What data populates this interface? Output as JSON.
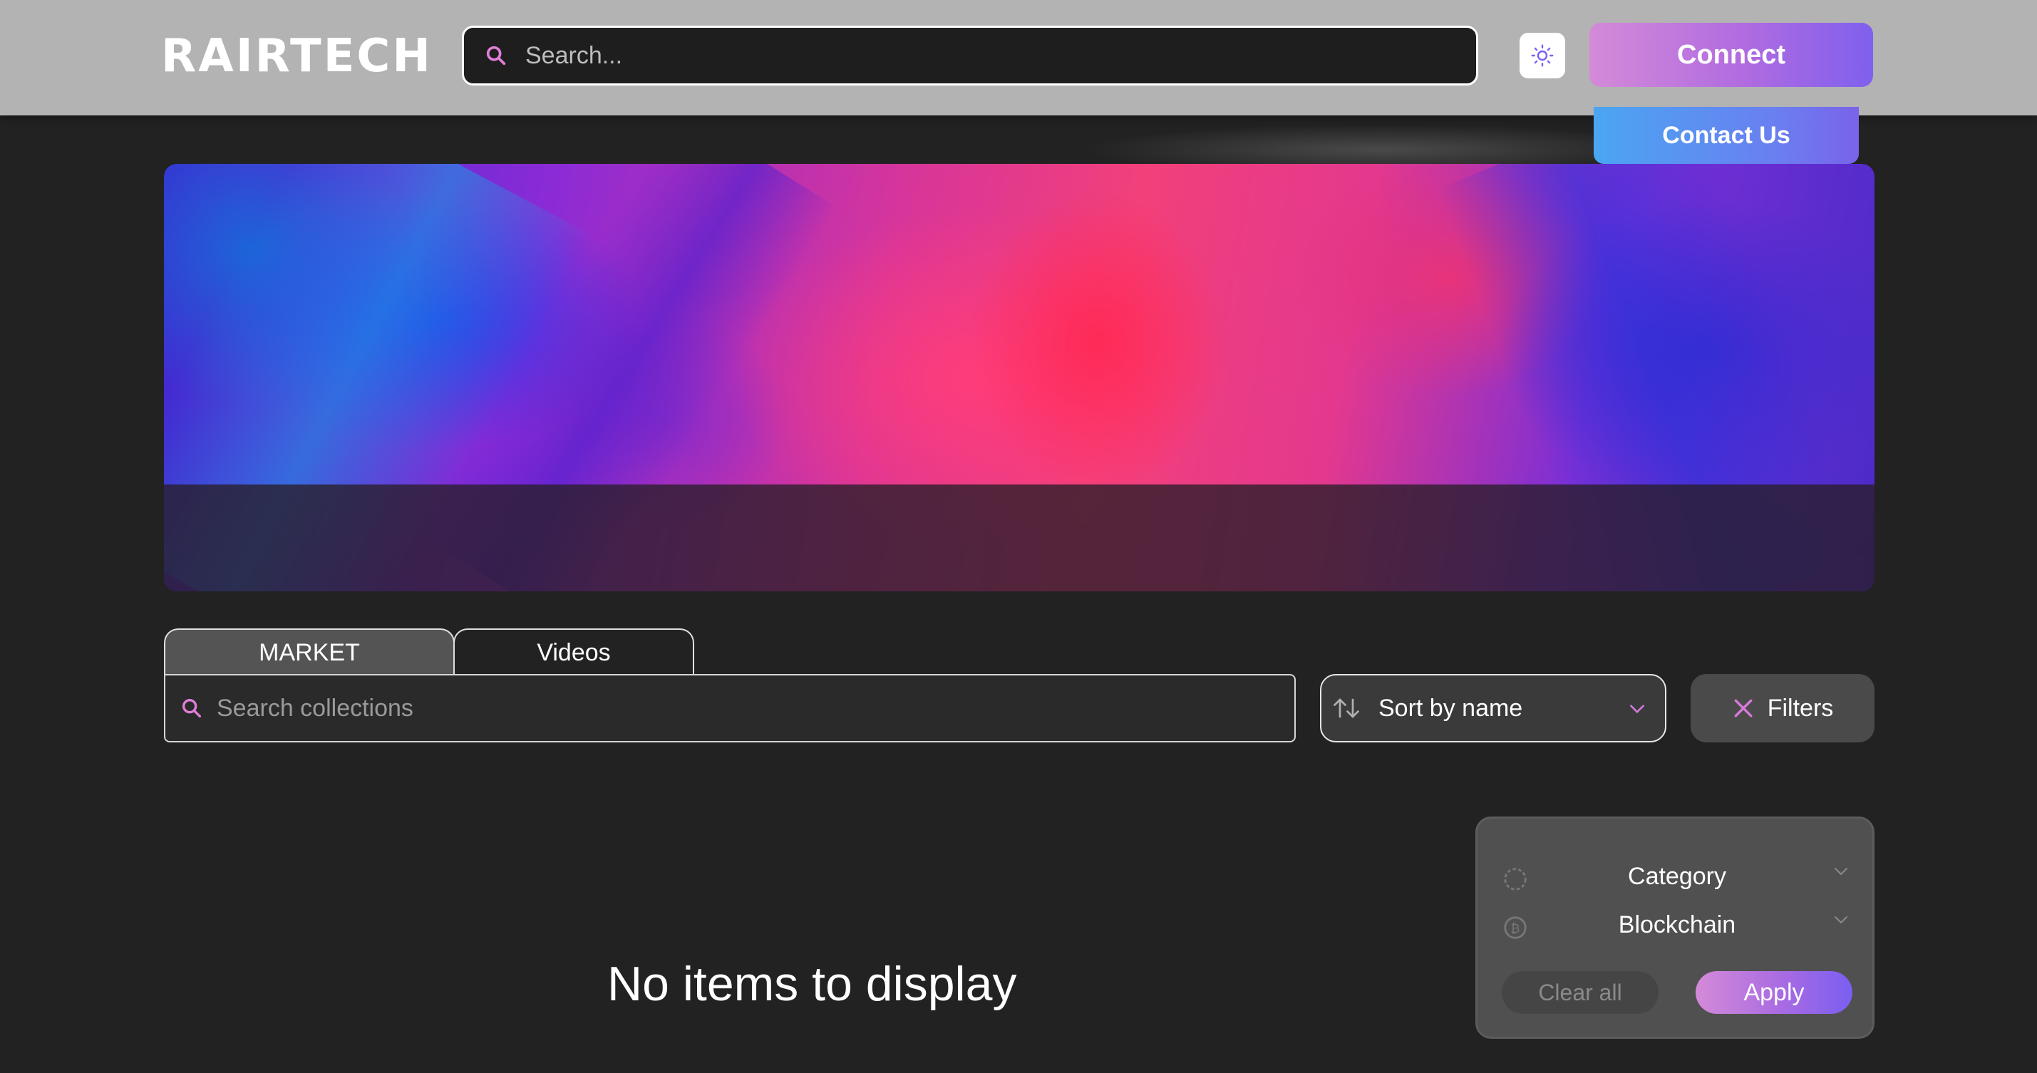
{
  "header": {
    "logo_text": "RAIRTECH",
    "search_placeholder": "Search...",
    "theme_toggle_icon": "sun-icon",
    "connect_label": "Connect",
    "contact_label": "Contact Us"
  },
  "tabs": [
    {
      "label": "MARKET",
      "active": true
    },
    {
      "label": "Videos",
      "active": false
    }
  ],
  "toolbar": {
    "collection_search_placeholder": "Search collections",
    "sort_label": "Sort by name",
    "filters_label": "Filters"
  },
  "filter_panel": {
    "items": [
      {
        "label": "Category",
        "icon": "spinner-icon"
      },
      {
        "label": "Blockchain",
        "icon": "bitcoin-icon"
      }
    ],
    "clear_label": "Clear all",
    "apply_label": "Apply"
  },
  "empty_state": {
    "message": "No items to display"
  },
  "colors": {
    "header_bg": "#b3b3b3",
    "page_bg": "#222222",
    "accent_gradient_start": "#d48ad8",
    "accent_gradient_end": "#7f60ee",
    "contact_gradient_start": "#4aa6f2"
  }
}
